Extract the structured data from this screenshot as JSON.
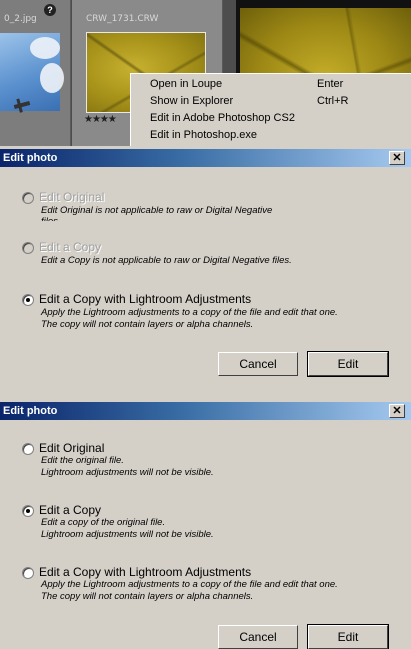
{
  "lightroom": {
    "cells": [
      {
        "filename": "0_2.jpg"
      },
      {
        "filename": "CRW_1731.CRW",
        "stars": "★★★★"
      }
    ],
    "badge": "?"
  },
  "context_menu": {
    "items": [
      {
        "label": "Open in Loupe",
        "shortcut": "Enter"
      },
      {
        "label": "Show in Explorer",
        "shortcut": "Ctrl+R"
      },
      {
        "label": "Edit in Adobe Photoshop CS2",
        "shortcut": ""
      },
      {
        "label": "Edit in Photoshop.exe",
        "shortcut": ""
      }
    ]
  },
  "dialog1": {
    "title": "Edit photo",
    "close_glyph": "✕",
    "options": [
      {
        "label": "Edit Original",
        "desc": [
          "Edit Original is not applicable to raw or Digital Negative",
          "files."
        ],
        "enabled": false,
        "selected": false
      },
      {
        "label": "Edit a Copy",
        "desc": [
          "Edit a Copy is not applicable to raw or Digital Negative files."
        ],
        "enabled": false,
        "selected": false
      },
      {
        "label": "Edit a Copy with Lightroom Adjustments",
        "desc": [
          "Apply the Lightroom adjustments to a copy of the file and edit that one.",
          "The copy will not contain layers or alpha channels."
        ],
        "enabled": true,
        "selected": true
      }
    ],
    "cancel_label": "Cancel",
    "edit_label": "Edit"
  },
  "dialog2": {
    "title": "Edit photo",
    "close_glyph": "✕",
    "options": [
      {
        "label": "Edit Original",
        "desc": [
          "Edit the original file.",
          "Lightroom adjustments will not be visible."
        ],
        "enabled": true,
        "selected": false
      },
      {
        "label": "Edit a Copy",
        "desc": [
          "Edit a copy of the original file.",
          "Lightroom adjustments will not be visible."
        ],
        "enabled": true,
        "selected": true
      },
      {
        "label": "Edit a Copy with Lightroom Adjustments",
        "desc": [
          "Apply the Lightroom adjustments to a copy of the file and edit that one.",
          "The copy will not contain layers or alpha channels."
        ],
        "enabled": true,
        "selected": false
      }
    ],
    "cancel_label": "Cancel",
    "edit_label": "Edit"
  }
}
